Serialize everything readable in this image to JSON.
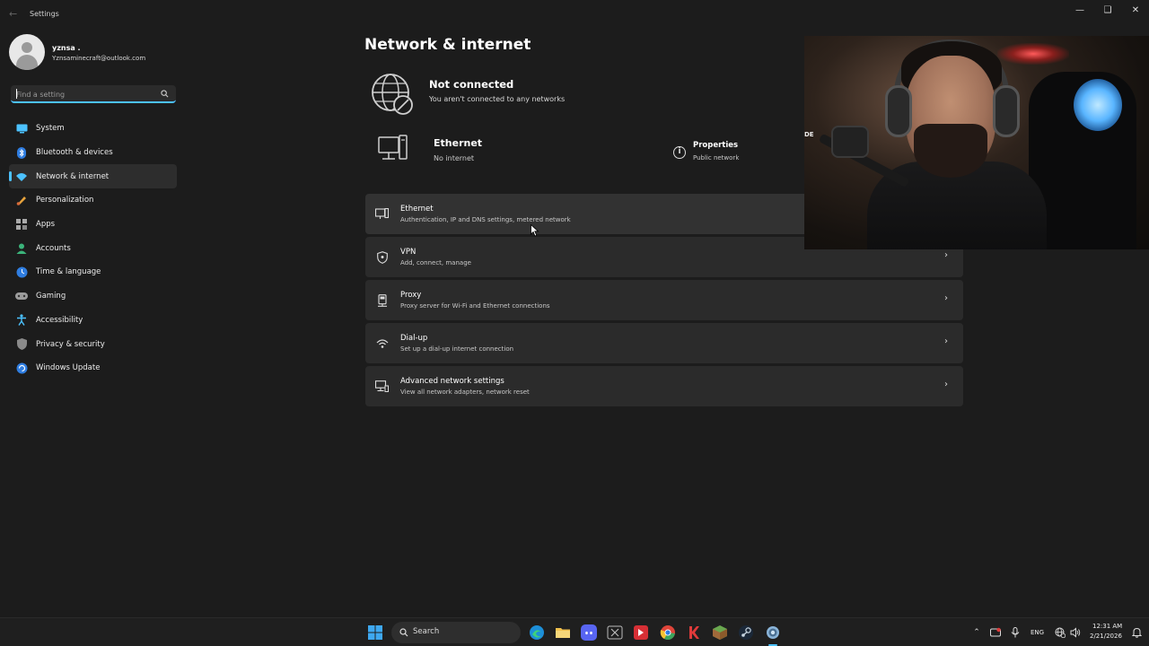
{
  "window": {
    "title": "Settings"
  },
  "profile": {
    "name": "yznsa .",
    "email": "Yznsaminecraft@outlook.com"
  },
  "search": {
    "placeholder": "Find a setting"
  },
  "sidebar": {
    "items": [
      {
        "label": "System",
        "icon": "monitor-icon"
      },
      {
        "label": "Bluetooth & devices",
        "icon": "bluetooth-icon"
      },
      {
        "label": "Network & internet",
        "icon": "wifi-icon",
        "active": true
      },
      {
        "label": "Personalization",
        "icon": "brush-icon"
      },
      {
        "label": "Apps",
        "icon": "apps-icon"
      },
      {
        "label": "Accounts",
        "icon": "person-icon"
      },
      {
        "label": "Time & language",
        "icon": "globe-clock-icon"
      },
      {
        "label": "Gaming",
        "icon": "gamepad-icon"
      },
      {
        "label": "Accessibility",
        "icon": "accessibility-icon"
      },
      {
        "label": "Privacy & security",
        "icon": "shield-icon"
      },
      {
        "label": "Windows Update",
        "icon": "update-icon"
      }
    ]
  },
  "main": {
    "title": "Network & internet",
    "status": {
      "title": "Not connected",
      "subtitle": "You aren't connected to any networks"
    },
    "ethernet": {
      "title": "Ethernet",
      "subtitle": "No internet"
    },
    "properties": {
      "title": "Properties",
      "subtitle": "Public network"
    },
    "cards": [
      {
        "title": "Ethernet",
        "subtitle": "Authentication, IP and DNS settings, metered network",
        "icon": "ethernet-icon"
      },
      {
        "title": "VPN",
        "subtitle": "Add, connect, manage",
        "icon": "vpn-shield-icon"
      },
      {
        "title": "Proxy",
        "subtitle": "Proxy server for Wi-Fi and Ethernet connections",
        "icon": "proxy-icon"
      },
      {
        "title": "Dial-up",
        "subtitle": "Set up a dial-up internet connection",
        "icon": "dialup-icon"
      },
      {
        "title": "Advanced network settings",
        "subtitle": "View all network adapters, network reset",
        "icon": "advanced-network-icon"
      }
    ]
  },
  "webcam": {
    "overlay_text": "DE"
  },
  "taskbar": {
    "search_label": "Search",
    "apps": [
      "start-icon",
      "edge-icon",
      "file-explorer-icon",
      "discord-icon",
      "excel-icon",
      "red-app-icon",
      "chrome-icon",
      "red-k-app-icon",
      "minecraft-icon",
      "steam-icon",
      "settings-icon"
    ],
    "language": "ENG",
    "time": "12:31 AM",
    "date": "2/21/2026"
  },
  "colors": {
    "accent": "#4cc2ff",
    "background": "#1c1c1c",
    "card": "#2b2b2b"
  }
}
